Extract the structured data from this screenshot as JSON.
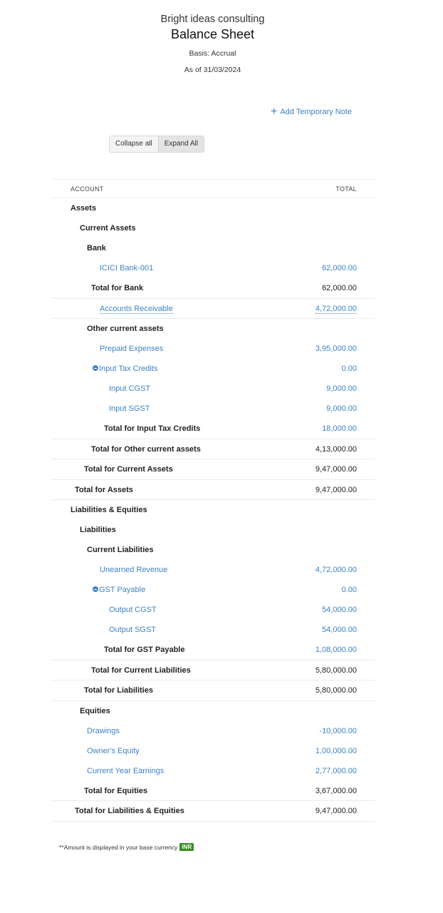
{
  "report": {
    "company": "Bright ideas consulting",
    "title": "Balance Sheet",
    "basis": "Basis: Accrual",
    "as_of": "As of 31/03/2024"
  },
  "actions": {
    "add_note": "Add Temporary Note",
    "collapse_all": "Collapse all",
    "expand_all": "Expand All"
  },
  "table": {
    "col_account": "ACCOUNT",
    "col_total": "TOTAL",
    "rows": [
      {
        "label": "Assets",
        "value": "",
        "kind": "heading",
        "level": 0
      },
      {
        "label": "Current Assets",
        "value": "",
        "kind": "heading",
        "level": 1
      },
      {
        "label": "Bank",
        "value": "",
        "kind": "heading",
        "level": 2
      },
      {
        "label": "ICICI Bank-001",
        "value": "62,000.00",
        "kind": "account",
        "level": 3
      },
      {
        "label": "Total for Bank",
        "value": "62,000.00",
        "kind": "total",
        "level": 2
      },
      {
        "label": "Accounts Receivable",
        "value": "4,72,000.00",
        "kind": "account-dotted",
        "level": 3
      },
      {
        "label": "Other current assets",
        "value": "",
        "kind": "heading",
        "level": 2
      },
      {
        "label": "Prepaid Expenses",
        "value": "3,95,000.00",
        "kind": "account",
        "level": 3
      },
      {
        "label": "Input Tax Credits",
        "value": "0.00",
        "kind": "parent",
        "level": 3
      },
      {
        "label": "Input CGST",
        "value": "9,000.00",
        "kind": "account",
        "level": 4
      },
      {
        "label": "Input SGST",
        "value": "9,000.00",
        "kind": "account",
        "level": 4
      },
      {
        "label": "Total for Input Tax Credits",
        "value": "18,000.00",
        "kind": "subtotal-blue",
        "level": 3
      },
      {
        "label": "Total for Other current assets",
        "value": "4,13,000.00",
        "kind": "total",
        "level": 2
      },
      {
        "label": "Total for Current Assets",
        "value": "9,47,000.00",
        "kind": "total",
        "level": 1
      },
      {
        "label": "Total for Assets",
        "value": "9,47,000.00",
        "kind": "total",
        "level": 0
      },
      {
        "label": "Liabilities & Equities",
        "value": "",
        "kind": "heading",
        "level": 0
      },
      {
        "label": "Liabilities",
        "value": "",
        "kind": "heading",
        "level": 1
      },
      {
        "label": "Current Liabilities",
        "value": "",
        "kind": "heading",
        "level": 2
      },
      {
        "label": "Unearned Revenue",
        "value": "4,72,000.00",
        "kind": "account",
        "level": 3
      },
      {
        "label": "GST Payable",
        "value": "0.00",
        "kind": "parent",
        "level": 3
      },
      {
        "label": "Output CGST",
        "value": "54,000.00",
        "kind": "account",
        "level": 4
      },
      {
        "label": "Output SGST",
        "value": "54,000.00",
        "kind": "account",
        "level": 4
      },
      {
        "label": "Total for GST Payable",
        "value": "1,08,000.00",
        "kind": "subtotal-blue",
        "level": 3
      },
      {
        "label": "Total for Current Liabilities",
        "value": "5,80,000.00",
        "kind": "total",
        "level": 2
      },
      {
        "label": "Total for Liabilities",
        "value": "5,80,000.00",
        "kind": "total",
        "level": 1
      },
      {
        "label": "Equities",
        "value": "",
        "kind": "heading",
        "level": 1
      },
      {
        "label": "Drawings",
        "value": "-10,000.00",
        "kind": "account",
        "level": 2
      },
      {
        "label": "Owner's Equity",
        "value": "1,00,000.00",
        "kind": "account",
        "level": 2
      },
      {
        "label": "Current Year Earnings",
        "value": "2,77,000.00",
        "kind": "account",
        "level": 2
      },
      {
        "label": "Total for Equities",
        "value": "3,67,000.00",
        "kind": "total",
        "level": 1
      },
      {
        "label": "Total for Liabilities & Equities",
        "value": "9,47,000.00",
        "kind": "total",
        "level": 0
      }
    ]
  },
  "footer": {
    "note": "**Amount is displayed in your base currency",
    "currency": "INR"
  },
  "colors": {
    "link": "#3d83c5",
    "currency_badge": "#3a8a25"
  }
}
